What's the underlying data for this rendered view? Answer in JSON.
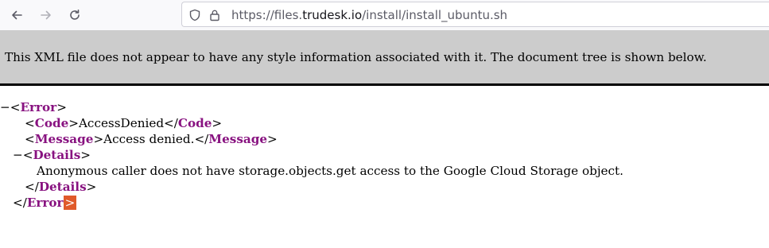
{
  "toolbar": {
    "url_prefix": "https://files.",
    "url_host": "trudesk.io",
    "url_path": "/install/install_ubuntu.sh"
  },
  "banner": {
    "text": "This XML file does not appear to have any style information associated with it. The document tree is shown below."
  },
  "xml": {
    "collapse_marker": "−",
    "lt": "<",
    "gt": ">",
    "lt_slash": "</",
    "root_tag": "Error",
    "code_tag": "Code",
    "code_value": "AccessDenied",
    "message_tag": "Message",
    "message_value": "Access denied.",
    "details_tag": "Details",
    "details_value": "Anonymous caller does not have storage.objects.get access to the Google Cloud Storage object."
  },
  "colors": {
    "tag": "#881280",
    "banner_bg": "#cccccc",
    "caret_bg": "#e05a2a"
  }
}
